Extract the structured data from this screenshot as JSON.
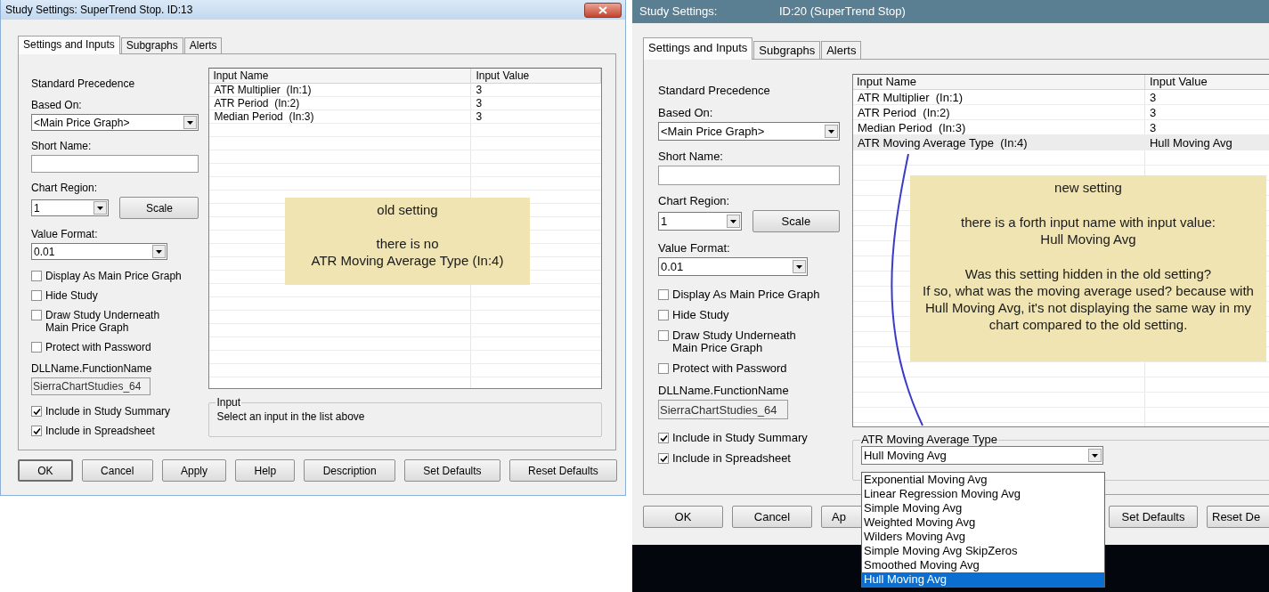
{
  "dialogs": [
    {
      "title_parts": [
        "Study Settings: SuperTrend Stop. ID:13"
      ],
      "closable": true,
      "tabs": [
        {
          "label": "Settings and Inputs",
          "selected": true
        },
        {
          "label": "Subgraphs",
          "selected": false
        },
        {
          "label": "Alerts",
          "selected": false
        }
      ],
      "precedence": "Standard Precedence",
      "based_on": {
        "label": "Based On:",
        "value": "<Main Price Graph>"
      },
      "short_name": {
        "label": "Short Name:"
      },
      "chart_region": {
        "label": "Chart Region:",
        "value": "1",
        "button": "Scale"
      },
      "value_format": {
        "label": "Value Format:",
        "value": "0.01"
      },
      "options": [
        {
          "label": "Display As Main Price Graph",
          "checked": false
        },
        {
          "label": "Hide Study",
          "checked": false
        },
        {
          "label": "Draw Study Underneath\nMain Price Graph",
          "checked": false
        },
        {
          "label": "Protect with Password",
          "checked": false
        }
      ],
      "dll": {
        "label": "DLLName.FunctionName",
        "value": "SierraChartStudies_64"
      },
      "include_options": [
        {
          "label": "Include in Study Summary",
          "checked": true
        },
        {
          "label": "Include in Spreadsheet",
          "checked": true
        }
      ],
      "grid": {
        "columns": [
          "Input Name",
          "Input Value"
        ],
        "rows": [
          {
            "name": "ATR Multiplier  (In:1)",
            "value": "3",
            "selected": false
          },
          {
            "name": "ATR Period  (In:2)",
            "value": "3",
            "selected": false
          },
          {
            "name": "Median Period  (In:3)",
            "value": "3",
            "selected": false
          }
        ]
      },
      "detail": {
        "kind": "info",
        "title": "Input",
        "text": "Select an input in the list above"
      },
      "buttons": [
        {
          "label": "OK",
          "default": true
        },
        {
          "label": "Cancel",
          "default": false
        },
        {
          "label": "Apply",
          "default": false
        },
        {
          "label": "Help",
          "default": false
        },
        {
          "label": "Description",
          "default": false
        },
        {
          "label": "Set Defaults",
          "default": false
        },
        {
          "label": "Reset Defaults",
          "default": false
        }
      ],
      "note": {
        "paragraphs": [
          [
            "old setting"
          ],
          [
            "there is no",
            "ATR Moving Average Type (In:4)"
          ]
        ]
      }
    },
    {
      "title_parts": [
        "Study Settings:",
        "ID:20 (SuperTrend Stop)"
      ],
      "closable": false,
      "tabs": [
        {
          "label": "Settings and Inputs",
          "selected": true
        },
        {
          "label": "Subgraphs",
          "selected": false
        },
        {
          "label": "Alerts",
          "selected": false
        }
      ],
      "precedence": "Standard Precedence",
      "based_on": {
        "label": "Based On:",
        "value": "<Main Price Graph>"
      },
      "short_name": {
        "label": "Short Name:"
      },
      "chart_region": {
        "label": "Chart Region:",
        "value": "1",
        "button": "Scale"
      },
      "value_format": {
        "label": "Value Format:",
        "value": "0.01"
      },
      "options": [
        {
          "label": "Display As Main Price Graph",
          "checked": false
        },
        {
          "label": "Hide Study",
          "checked": false
        },
        {
          "label": "Draw Study Underneath\nMain Price Graph",
          "checked": false
        },
        {
          "label": "Protect with Password",
          "checked": false
        }
      ],
      "dll": {
        "label": "DLLName.FunctionName",
        "value": "SierraChartStudies_64"
      },
      "include_options": [
        {
          "label": "Include in Study Summary",
          "checked": true
        },
        {
          "label": "Include in Spreadsheet",
          "checked": true
        }
      ],
      "grid": {
        "columns": [
          "Input Name",
          "Input Value"
        ],
        "rows": [
          {
            "name": "ATR Multiplier  (In:1)",
            "value": "3",
            "selected": false
          },
          {
            "name": "ATR Period  (In:2)",
            "value": "3",
            "selected": false
          },
          {
            "name": "Median Period  (In:3)",
            "value": "3",
            "selected": false
          },
          {
            "name": "ATR Moving Average Type  (In:4)",
            "value": "Hull Moving Avg",
            "selected": true
          }
        ]
      },
      "detail": {
        "kind": "select",
        "title": "ATR Moving Average Type",
        "value": "Hull Moving Avg",
        "options": [
          {
            "label": "Exponential Moving Avg",
            "selected": false
          },
          {
            "label": "Linear Regression Moving Avg",
            "selected": false
          },
          {
            "label": "Simple Moving Avg",
            "selected": false
          },
          {
            "label": "Weighted Moving Avg",
            "selected": false
          },
          {
            "label": "Wilders Moving Avg",
            "selected": false
          },
          {
            "label": "Simple Moving Avg SkipZeros",
            "selected": false
          },
          {
            "label": "Smoothed Moving Avg",
            "selected": false
          },
          {
            "label": "Hull Moving Avg",
            "selected": true
          }
        ]
      },
      "buttons": [
        {
          "label": "OK",
          "default": false
        },
        {
          "label": "Cancel",
          "default": false
        },
        {
          "label": "Ap",
          "default": false
        },
        {
          "label": "Set Defaults",
          "default": false
        },
        {
          "label": "Reset De",
          "default": false
        }
      ],
      "note": {
        "paragraphs": [
          [
            "new setting"
          ],
          [
            "there is a forth input name with input value:",
            "Hull Moving Avg"
          ],
          [
            "Was this setting hidden in the old setting?",
            "If so, what was the moving average used? because with Hull Moving Avg, it's not displaying the same way in my chart compared to the old setting."
          ]
        ]
      }
    }
  ]
}
